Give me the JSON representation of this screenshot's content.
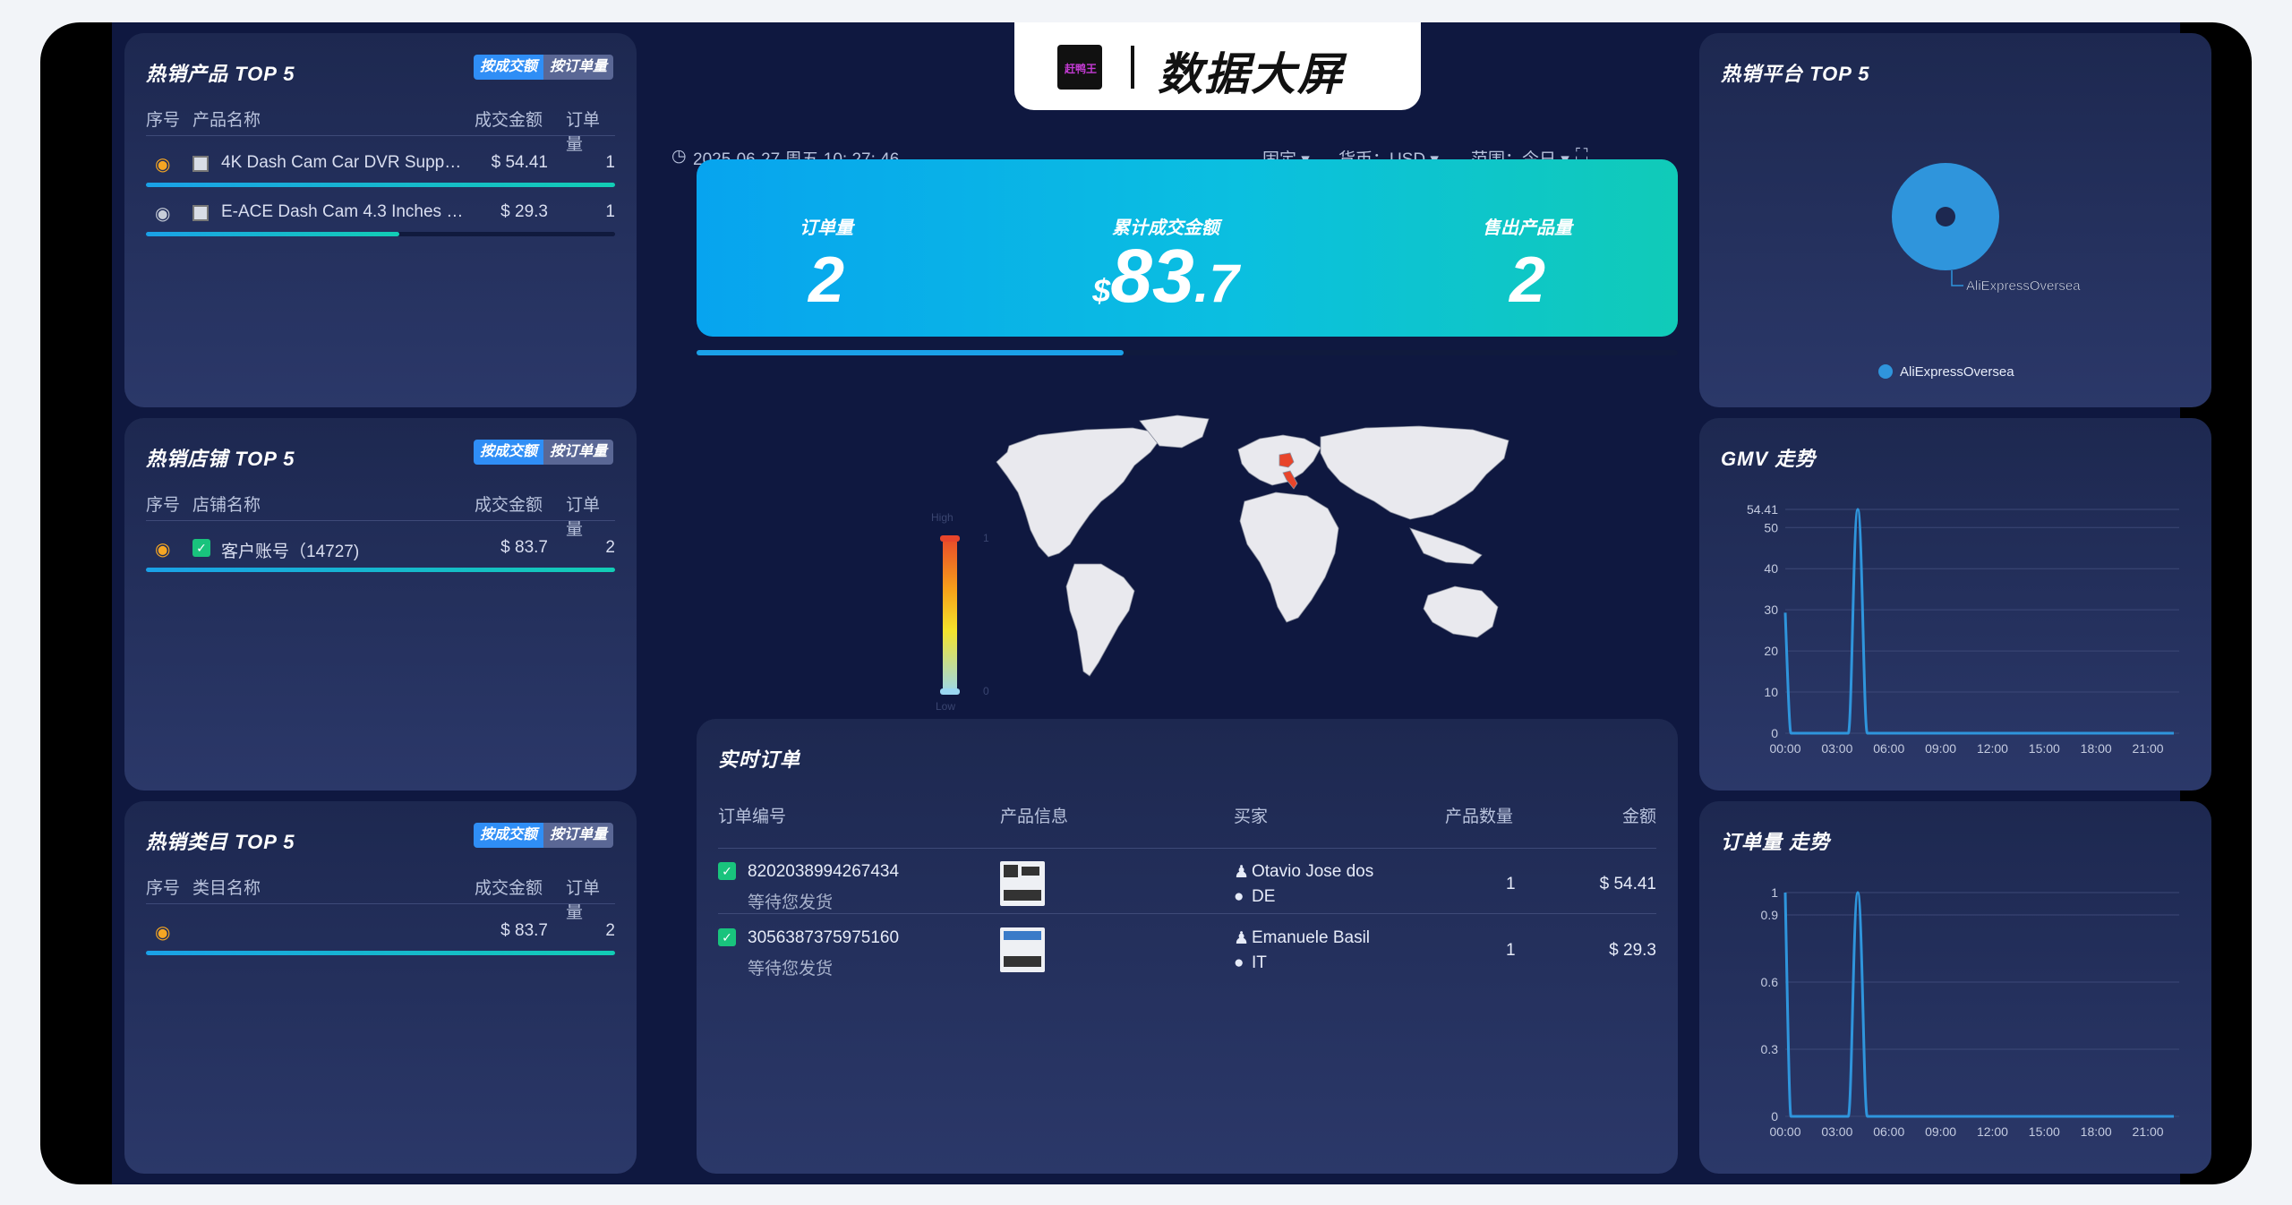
{
  "header": {
    "title": "数据大屏",
    "logo_text": "赶鸭王",
    "datetime": "2025-06-27 周五 10: 27: 46",
    "fixed_label": "固定",
    "currency_label": "货币：USD",
    "range_label": "范围：今日"
  },
  "top_products": {
    "title": "热销产品 TOP 5",
    "toggle": [
      "按成交额",
      "按订单量"
    ],
    "columns": [
      "序号",
      "产品名称",
      "成交金额",
      "订单量"
    ],
    "rows": [
      {
        "name": "4K Dash Cam Car DVR Supp…",
        "amount": "$ 54.41",
        "orders": "1",
        "share": 1.0
      },
      {
        "name": "E-ACE Dash Cam 4.3 Inches …",
        "amount": "$ 29.3",
        "orders": "1",
        "share": 0.54
      }
    ]
  },
  "top_stores": {
    "title": "热销店铺 TOP 5",
    "toggle": [
      "按成交额",
      "按订单量"
    ],
    "columns": [
      "序号",
      "店铺名称",
      "成交金额",
      "订单量"
    ],
    "rows": [
      {
        "name": "客户账号（14727)",
        "amount": "$ 83.7",
        "orders": "2",
        "share": 1.0
      }
    ]
  },
  "top_categories": {
    "title": "热销类目 TOP 5",
    "toggle": [
      "按成交额",
      "按订单量"
    ],
    "columns": [
      "序号",
      "类目名称",
      "成交金额",
      "订单量"
    ],
    "rows": [
      {
        "name": "",
        "amount": "$ 83.7",
        "orders": "2",
        "share": 1.0
      }
    ]
  },
  "kpis": {
    "orders_label": "订单量",
    "orders_value": "2",
    "gmv_label": "累计成交金额",
    "gmv_currency": "$",
    "gmv_int": "83",
    "gmv_dec": ".7",
    "sold_label": "售出产品量",
    "sold_value": "2",
    "progress": 0.435
  },
  "map": {
    "legend_high": "High",
    "legend_low": "Low",
    "legend_max": "1",
    "legend_min": "0",
    "highlighted_countries": [
      "DE",
      "IT"
    ]
  },
  "realtime_orders": {
    "title": "实时订单",
    "columns": [
      "订单编号",
      "产品信息",
      "买家",
      "产品数量",
      "金额"
    ],
    "rows": [
      {
        "order_no": "8202038994267434",
        "status": "等待您发货",
        "buyer": "Otavio Jose dos",
        "country": "DE",
        "qty": "1",
        "amount": "$ 54.41"
      },
      {
        "order_no": "3056387375975160",
        "status": "等待您发货",
        "buyer": "Emanuele Basil",
        "country": "IT",
        "qty": "1",
        "amount": "$ 29.3"
      }
    ]
  },
  "top_platforms": {
    "title": "热销平台 TOP 5",
    "chart_data": {
      "type": "pie",
      "slices": [
        {
          "label": "AliExpressOversea",
          "value": 1
        }
      ],
      "legend": [
        "AliExpressOversea"
      ],
      "color": "#2f95dc"
    }
  },
  "gmv_trend": {
    "title": "GMV 走势",
    "chart_data": {
      "type": "line",
      "x_ticks": [
        "00:00",
        "03:00",
        "06:00",
        "09:00",
        "12:00",
        "15:00",
        "18:00",
        "21:00"
      ],
      "y_ticks": [
        "0",
        "10",
        "20",
        "30",
        "40",
        "50",
        "54.41"
      ],
      "ylim": [
        0,
        54.41
      ],
      "series": [
        {
          "points": [
            [
              0,
              29.3
            ],
            [
              4.2,
              54.41
            ]
          ]
        }
      ],
      "color": "#2f95dc"
    }
  },
  "orders_trend": {
    "title": "订单量 走势",
    "chart_data": {
      "type": "line",
      "x_ticks": [
        "00:00",
        "03:00",
        "06:00",
        "09:00",
        "12:00",
        "15:00",
        "18:00",
        "21:00"
      ],
      "y_ticks": [
        "0",
        "0.3",
        "0.6",
        "0.9",
        "1"
      ],
      "ylim": [
        0,
        1
      ],
      "series": [
        {
          "points": [
            [
              0,
              1
            ],
            [
              4.2,
              1
            ]
          ]
        }
      ],
      "color": "#2f95dc"
    }
  }
}
